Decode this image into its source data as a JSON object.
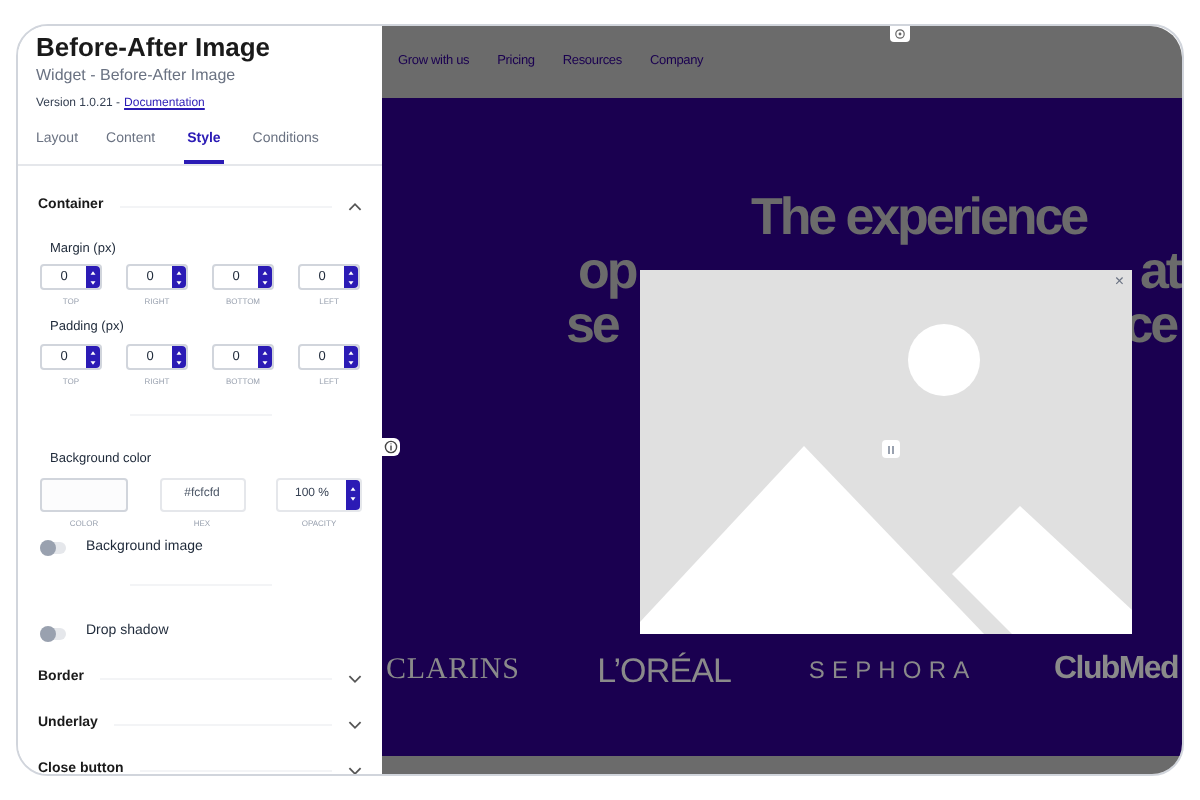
{
  "panel": {
    "title": "Before-After Image",
    "subtitle": "Widget - Before-After Image",
    "version": "Version 1.0.21 -",
    "documentation_link": "Documentation"
  },
  "tabs": [
    {
      "label": "Layout",
      "selected": false
    },
    {
      "label": "Content",
      "selected": false
    },
    {
      "label": "Style",
      "selected": true
    },
    {
      "label": "Conditions",
      "selected": false
    }
  ],
  "sections": [
    {
      "title": "Container",
      "expanded": true,
      "body": {
        "spacing": [
          {
            "label": "Margin (px)",
            "fields": [
              {
                "value": "0",
                "caption": "TOP"
              },
              {
                "value": "0",
                "caption": "RIGHT"
              },
              {
                "value": "0",
                "caption": "BOTTOM"
              },
              {
                "value": "0",
                "caption": "LEFT"
              }
            ]
          },
          {
            "label": "Padding (px)",
            "fields": [
              {
                "value": "0",
                "caption": "TOP"
              },
              {
                "value": "0",
                "caption": "RIGHT"
              },
              {
                "value": "0",
                "caption": "BOTTOM"
              },
              {
                "value": "0",
                "caption": "LEFT"
              }
            ]
          }
        ],
        "background": {
          "label": "Background color",
          "color": "#fcfcfd",
          "hex": "#fcfcfd",
          "opacity": "100 %",
          "captions": [
            "COLOR",
            "HEX",
            "OPACITY"
          ]
        },
        "toggles": [
          {
            "label": "Background image",
            "on": false
          },
          {
            "label": "Drop shadow",
            "on": false
          }
        ]
      }
    },
    {
      "title": "Border",
      "expanded": false
    },
    {
      "title": "Underlay",
      "expanded": false
    },
    {
      "title": "Close button",
      "expanded": false
    }
  ],
  "preview": {
    "nav": [
      "Grow with us",
      "Pricing",
      "Resources",
      "Company"
    ],
    "hero": {
      "line_1": "The experience",
      "line_2_left": "op",
      "line_2_right": "at",
      "line_3_left": "se",
      "line_3_right": "ce"
    },
    "logos": [
      "CLARINS",
      "L’ORÉAL",
      "SEPHORA",
      "ClubMed"
    ],
    "modal": {
      "close": "×"
    }
  }
}
